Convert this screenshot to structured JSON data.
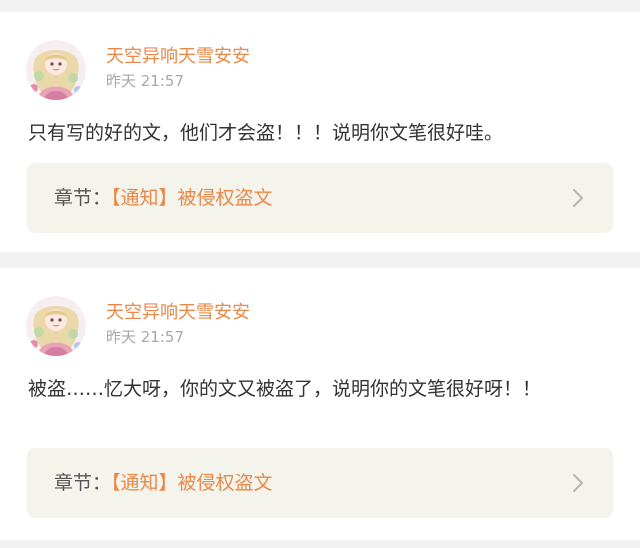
{
  "posts": [
    {
      "username": "天空异响天雪安安",
      "time": "昨天 21:57",
      "content": "只有写的好的文，他们才会盗！！！说明你文笔很好哇。",
      "chapter_prefix": "章节：",
      "chapter_title": "【通知】被侵权盗文"
    },
    {
      "username": "天空异响天雪安安",
      "time": "昨天 21:57",
      "content": "被盗……忆大呀，你的文又被盗了，说明你的文笔很好呀！！",
      "chapter_prefix": "章节：",
      "chapter_title": "【通知】被侵权盗文"
    }
  ],
  "icons": {
    "avatar": "anime-girl-avatar",
    "chevron": "chevron-right-icon"
  },
  "colors": {
    "username": "#e8894a",
    "chapter_highlight": "#e8894a",
    "time": "#a8a8a8",
    "chapter_bg": "#f4f4ec",
    "page_bg": "#f1f1f1"
  }
}
